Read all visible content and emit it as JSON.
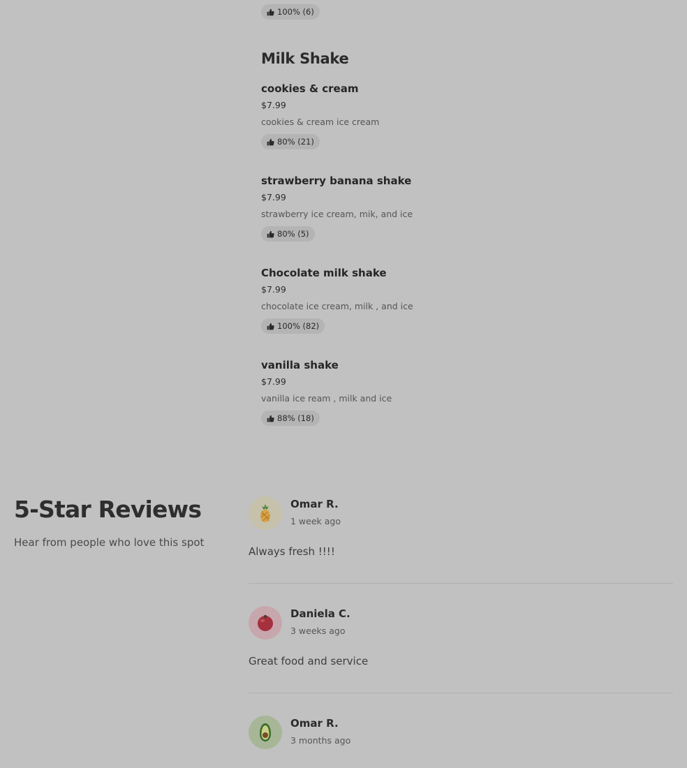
{
  "menu": {
    "previous_item_rating": "100% (6)",
    "section_title": "Milk Shake",
    "items": [
      {
        "name": "cookies & cream",
        "price": "$7.99",
        "description": "cookies & cream ice cream",
        "rating": "80% (21)"
      },
      {
        "name": "strawberry banana shake",
        "price": "$7.99",
        "description": "strawberry ice cream, mik, and ice",
        "rating": "80% (5)"
      },
      {
        "name": "Chocolate milk shake",
        "price": "$7.99",
        "description": "chocolate ice cream, milk , and ice",
        "rating": "100% (82)"
      },
      {
        "name": "vanilla shake",
        "price": "$7.99",
        "description": "vanilla ice ream , milk and ice",
        "rating": "88% (18)"
      }
    ]
  },
  "reviews": {
    "title": "5-Star Reviews",
    "subtitle": "Hear from people who love this spot",
    "items": [
      {
        "name": "Omar R.",
        "date": "1 week ago",
        "text": "Always fresh !!!!",
        "avatar_icon": "pineapple-icon",
        "avatar_bg": "#c6c1aa"
      },
      {
        "name": "Daniela C.",
        "date": "3 weeks ago",
        "text": "Great food and service",
        "avatar_icon": "cherry-tomato-icon",
        "avatar_bg": "#c7a7ad"
      },
      {
        "name": "Omar R.",
        "date": "3 months ago",
        "text": "",
        "avatar_icon": "avocado-icon",
        "avatar_bg": "#a7b697"
      }
    ]
  },
  "colors": {
    "overlay_background": "#c1c1c1",
    "rating_pill": "#b4b4b4"
  }
}
